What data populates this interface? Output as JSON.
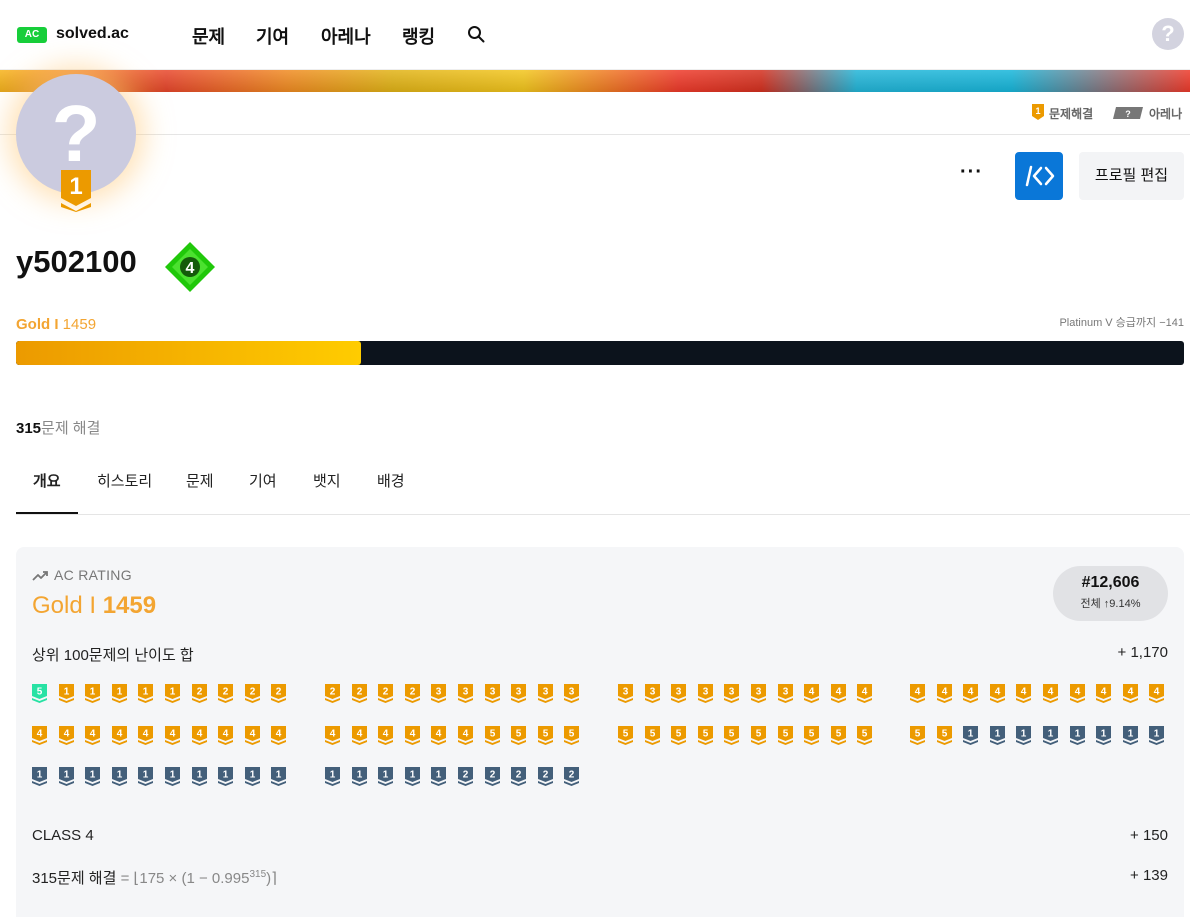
{
  "header": {
    "logo_text": "AC",
    "brand": "solved.ac",
    "nav": [
      "문제",
      "기여",
      "아레나",
      "랭킹"
    ],
    "help_icon": "?"
  },
  "subbar": {
    "solve_label": "문제해결",
    "solve_tier": "1",
    "arena_label": "아레나",
    "arena_tier": "?"
  },
  "profile": {
    "avatar_glyph": "?",
    "avatar_tier": "1",
    "username": "y502100",
    "class": "4",
    "more": "···",
    "edit_label": "프로필 편집",
    "tier_name": "Gold I",
    "rating": "1459",
    "promotion": "Platinum V 승급까지 −141",
    "progress": 0.295,
    "solved_count": "315",
    "solved_suffix": "문제 해결"
  },
  "tabs": [
    "개요",
    "히스토리",
    "문제",
    "기여",
    "뱃지",
    "배경"
  ],
  "active_tab": 0,
  "rating_card": {
    "label": "AC RATING",
    "tier_name": "Gold I",
    "rating": "1459",
    "rank": "#12,606",
    "rank_pct": "전체 ↑9.14%",
    "top100_label": "상위 100문제의 난이도 합",
    "top100_value": "+ 1,170",
    "class_label": "CLASS 4",
    "class_value": "+ 150",
    "solved_label": "315문제 해결",
    "formula_prefix": " = ⌊175 × (1 − 0.995",
    "formula_exp": "315",
    "formula_suffix": ")⌉",
    "solved_value": "+ 139"
  },
  "colors": {
    "gold": "#ec9a00",
    "silver": "#435f7a",
    "platinum": "#27e2a4",
    "brand_green": "#17ce3a",
    "blue_button": "#0a77d8"
  },
  "problem_tiers": [
    [
      "p5",
      "g1",
      "g1",
      "g1",
      "g1",
      "g1",
      "g2",
      "g2",
      "g2",
      "g2"
    ],
    [
      "g2",
      "g2",
      "g2",
      "g2",
      "g3",
      "g3",
      "g3",
      "g3",
      "g3",
      "g3"
    ],
    [
      "g3",
      "g3",
      "g3",
      "g3",
      "g3",
      "g3",
      "g3",
      "g4",
      "g4",
      "g4"
    ],
    [
      "g4",
      "g4",
      "g4",
      "g4",
      "g4",
      "g4",
      "g4",
      "g4",
      "g4",
      "g4"
    ],
    [
      "g4",
      "g4",
      "g4",
      "g4",
      "g4",
      "g4",
      "g4",
      "g4",
      "g4",
      "g4"
    ],
    [
      "g4",
      "g4",
      "g4",
      "g4",
      "g4",
      "g4",
      "g5",
      "g5",
      "g5",
      "g5"
    ],
    [
      "g5",
      "g5",
      "g5",
      "g5",
      "g5",
      "g5",
      "g5",
      "g5",
      "g5",
      "g5"
    ],
    [
      "g5",
      "g5",
      "s1",
      "s1",
      "s1",
      "s1",
      "s1",
      "s1",
      "s1",
      "s1"
    ],
    [
      "s1",
      "s1",
      "s1",
      "s1",
      "s1",
      "s1",
      "s1",
      "s1",
      "s1",
      "s1"
    ],
    [
      "s1",
      "s1",
      "s1",
      "s1",
      "s1",
      "s2",
      "s2",
      "s2",
      "s2",
      "s2"
    ]
  ]
}
